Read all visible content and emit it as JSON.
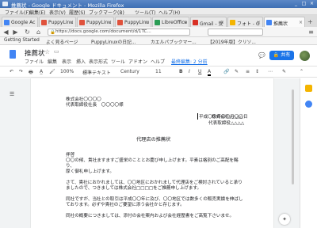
{
  "window": {
    "title": "推薦状 - Google ドキュメント - Mozilla Firefox",
    "controls": [
      "_",
      "□",
      "×"
    ]
  },
  "menubar": [
    "ファイル(F)",
    "編集(E)",
    "表示(V)",
    "履歴(S)",
    "ブックマーク(B)",
    "ツール(T)",
    "ヘルプ(H)"
  ],
  "tabs": [
    {
      "label": "Google Ac",
      "color": "#4285f4",
      "active": false
    },
    {
      "label": "PuppyLinu",
      "color": "#e0523c",
      "active": false
    },
    {
      "label": "PuppyLinu",
      "color": "#e0523c",
      "active": false
    },
    {
      "label": "PuppyLinu",
      "color": "#e0523c",
      "active": false
    },
    {
      "label": "LibreOffice",
      "color": "#2a9d55",
      "active": false
    },
    {
      "label": "Gmail - 受",
      "color": "#d93025",
      "active": false
    },
    {
      "label": "フォト - G",
      "color": "#f4b400",
      "active": false
    },
    {
      "label": "推薦状",
      "color": "#4285f4",
      "active": true
    }
  ],
  "navbar": {
    "url": "https://docs.google.com/document/d/1TC...",
    "back": "◀",
    "forward": "▶",
    "reload": "↻",
    "home": "⌂",
    "menu": "≡"
  },
  "bookmarks": [
    "Getting Started",
    "よく見るページ",
    "PuppyLinuxの日記...",
    "カエルパブックマー...",
    "【2019年版】クリソ..."
  ],
  "docs": {
    "title": "推薦状",
    "menu": [
      "ファイル",
      "編集",
      "表示",
      "挿入",
      "表示形式",
      "ツール",
      "アドオン",
      "ヘルプ"
    ],
    "last_edit": "最終編集: 2 分前",
    "share": "共有",
    "brand_color": "#1a73e8"
  },
  "toolbar": {
    "zoom": "100%",
    "style": "標準テキスト",
    "font": "Century",
    "size": "11",
    "bold": "B",
    "italic": "I",
    "underline": "U",
    "color": "A",
    "undo": "↶",
    "redo": "↷",
    "print": "🖶",
    "more": "⋯"
  },
  "document": {
    "date": "平成〇〇年〇〇月〇〇日",
    "addr1": "株式会社〇〇〇〇",
    "addr2": "代表取締役社長　〇〇〇〇様",
    "sender1": "株式会社△△△△",
    "sender2": "代表取締役△△△△",
    "heading": "代理店の推薦状",
    "p1": "拝啓",
    "p2": "〇〇の候、貴社ますますご盛栄のこととお慶び申し上げます。平素は格別のご高配を賜",
    "p3": "り、",
    "p4": "厚く御礼申し上げます。",
    "p5": "さて、貴社におかれましては、〇〇地区におかれまして代理店をご検討されていると承り",
    "p6": "ましたので、つきましては株式会社□□□□をご推薦申し上げます。",
    "p7": "同社ですが、当社との取引は平成〇〇年に及び、〇〇地区では数多くの販売実績を伸ばし",
    "p8": "ております。必ずや貴社のご要望に添う会社かと存じます。",
    "p9": "同社の概要につきましては、添付の会社案内および会社経歴書をご高覧下さいませ。"
  }
}
